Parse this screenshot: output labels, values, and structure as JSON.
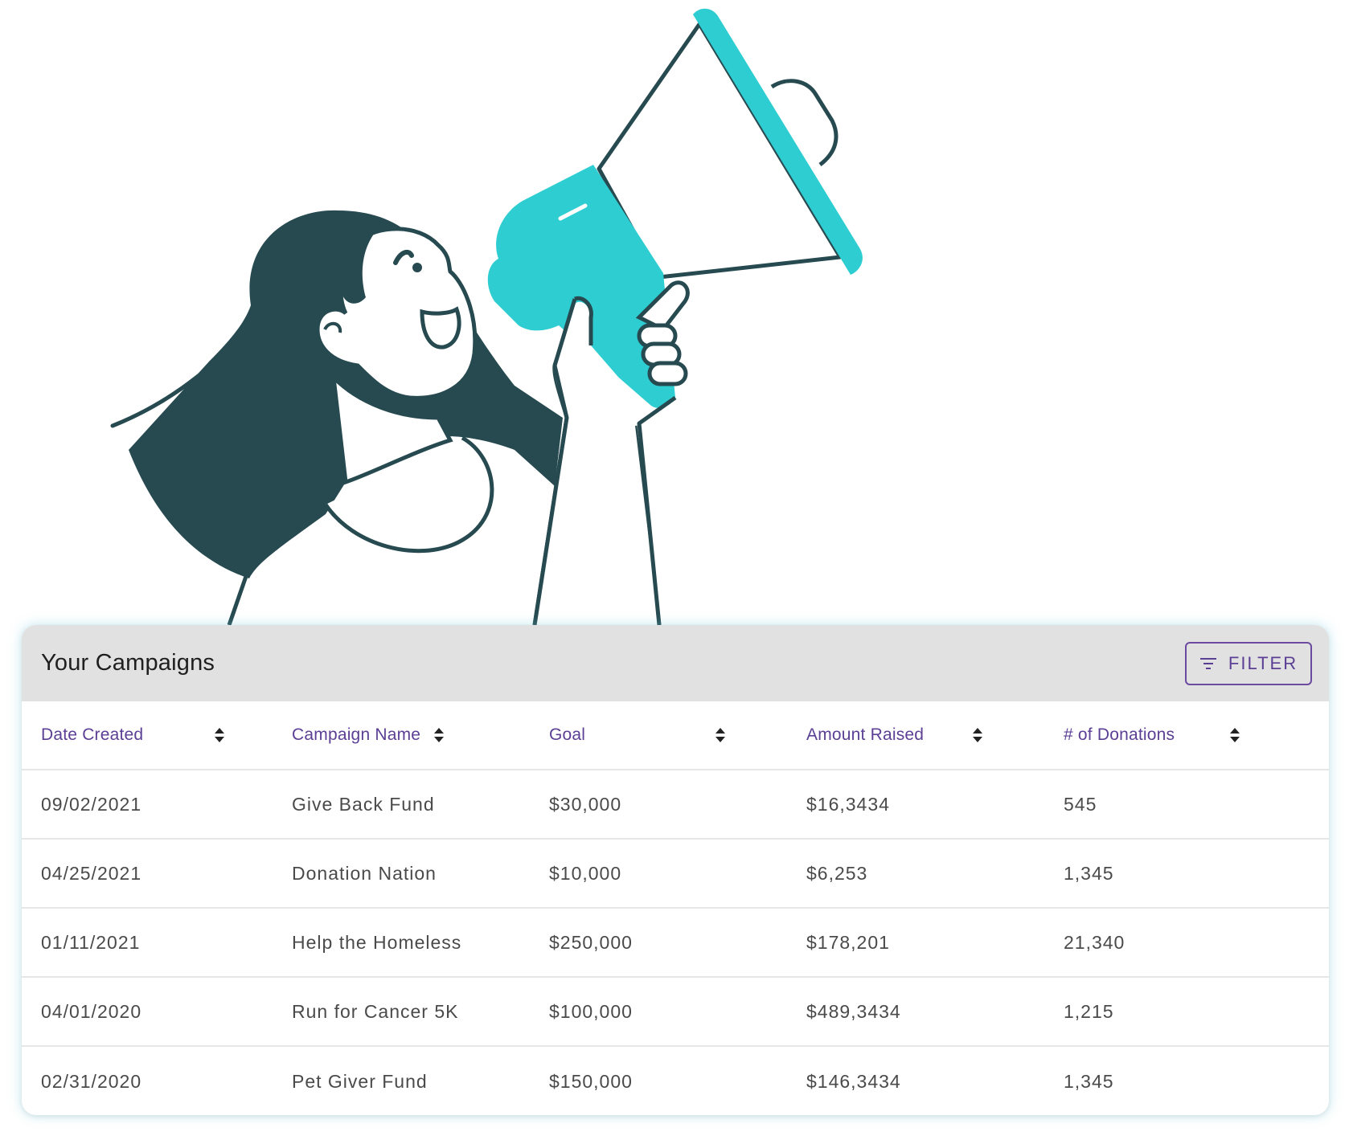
{
  "campaigns": {
    "title": "Your Campaigns",
    "filter_label": "FILTER",
    "columns": [
      {
        "label": "Date Created"
      },
      {
        "label": "Campaign Name"
      },
      {
        "label": "Goal"
      },
      {
        "label": "Amount Raised"
      },
      {
        "label": "# of Donations"
      }
    ],
    "rows": [
      {
        "date": "09/02/2021",
        "name": "Give Back Fund",
        "goal": "$30,000",
        "raised": "$16,3434",
        "donations": "545"
      },
      {
        "date": "04/25/2021",
        "name": "Donation Nation",
        "goal": "$10,000",
        "raised": "$6,253",
        "donations": "1,345"
      },
      {
        "date": "01/11/2021",
        "name": "Help the Homeless",
        "goal": "$250,000",
        "raised": "$178,201",
        "donations": "21,340"
      },
      {
        "date": "04/01/2020",
        "name": "Run for Cancer 5K",
        "goal": "$100,000",
        "raised": "$489,3434",
        "donations": "1,215"
      },
      {
        "date": "02/31/2020",
        "name": "Pet Giver Fund",
        "goal": "$150,000",
        "raised": "$146,3434",
        "donations": "1,345"
      }
    ]
  },
  "colors": {
    "accent_purple": "#5b3f94",
    "header_bg": "#e1e1e1",
    "illustration_dark": "#264a50",
    "illustration_teal": "#2ecdd1"
  },
  "illustration": {
    "subject": "woman-shouting-into-megaphone"
  }
}
